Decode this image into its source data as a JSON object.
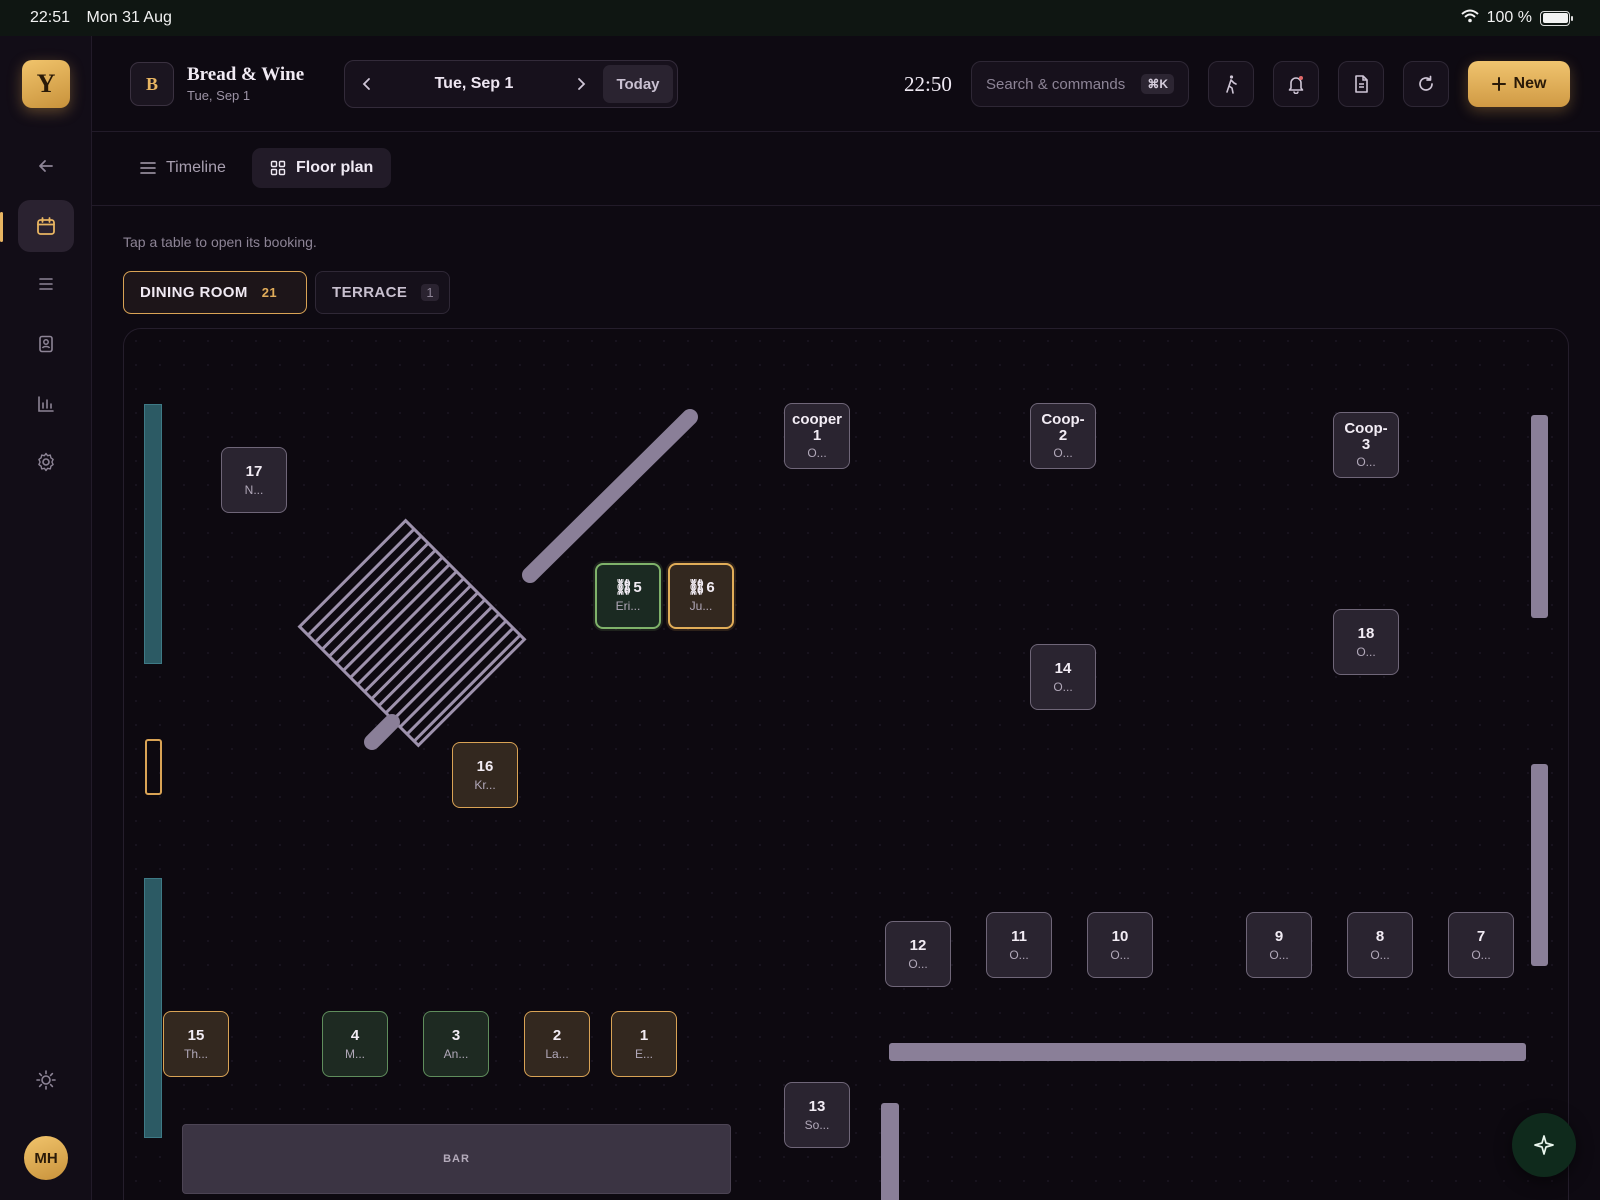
{
  "status_bar": {
    "time": "22:51",
    "date": "Mon 31 Aug",
    "battery": "100 %"
  },
  "sidebar": {
    "logo": "Y",
    "avatar": "MH"
  },
  "header": {
    "venue_initial": "B",
    "venue_name": "Bread & Wine",
    "venue_date": "Tue, Sep 1",
    "current_date": "Tue, Sep 1",
    "today_label": "Today",
    "clock": "22:50",
    "search_placeholder": "Search & commands",
    "search_shortcut": "⌘K",
    "new_label": "New"
  },
  "view_tabs": {
    "timeline": "Timeline",
    "floor_plan": "Floor plan"
  },
  "hint": "Tap a table to open its booking.",
  "areas": [
    {
      "label": "DINING ROOM",
      "count": "21"
    },
    {
      "label": "TERRACE",
      "count": "1"
    }
  ],
  "tables": {
    "t17": {
      "num": "17",
      "sub": "N..."
    },
    "cooper1": {
      "num": "cooper 1",
      "sub": "O..."
    },
    "coop2": {
      "num": "Coop-2",
      "sub": "O..."
    },
    "coop3": {
      "num": "Coop-3",
      "sub": "O..."
    },
    "t5": {
      "num": "⛓5",
      "sub": "Eri..."
    },
    "t6": {
      "num": "⛓6",
      "sub": "Ju..."
    },
    "t18": {
      "num": "18",
      "sub": "O..."
    },
    "t14": {
      "num": "14",
      "sub": "O..."
    },
    "t16": {
      "num": "16",
      "sub": "Kr..."
    },
    "t12": {
      "num": "12",
      "sub": "O..."
    },
    "t11": {
      "num": "11",
      "sub": "O..."
    },
    "t10": {
      "num": "10",
      "sub": "O..."
    },
    "t9": {
      "num": "9",
      "sub": "O..."
    },
    "t8": {
      "num": "8",
      "sub": "O..."
    },
    "t7": {
      "num": "7",
      "sub": "O..."
    },
    "t15": {
      "num": "15",
      "sub": "Th..."
    },
    "t4": {
      "num": "4",
      "sub": "M..."
    },
    "t3": {
      "num": "3",
      "sub": "An..."
    },
    "t2": {
      "num": "2",
      "sub": "La..."
    },
    "t1": {
      "num": "1",
      "sub": "E..."
    },
    "t13": {
      "num": "13",
      "sub": "So..."
    }
  },
  "bar_label": "BAR",
  "colors": {
    "accent": "#e8b562",
    "seated_green": "#5f8d5c",
    "booked_amber": "#d9a355"
  }
}
